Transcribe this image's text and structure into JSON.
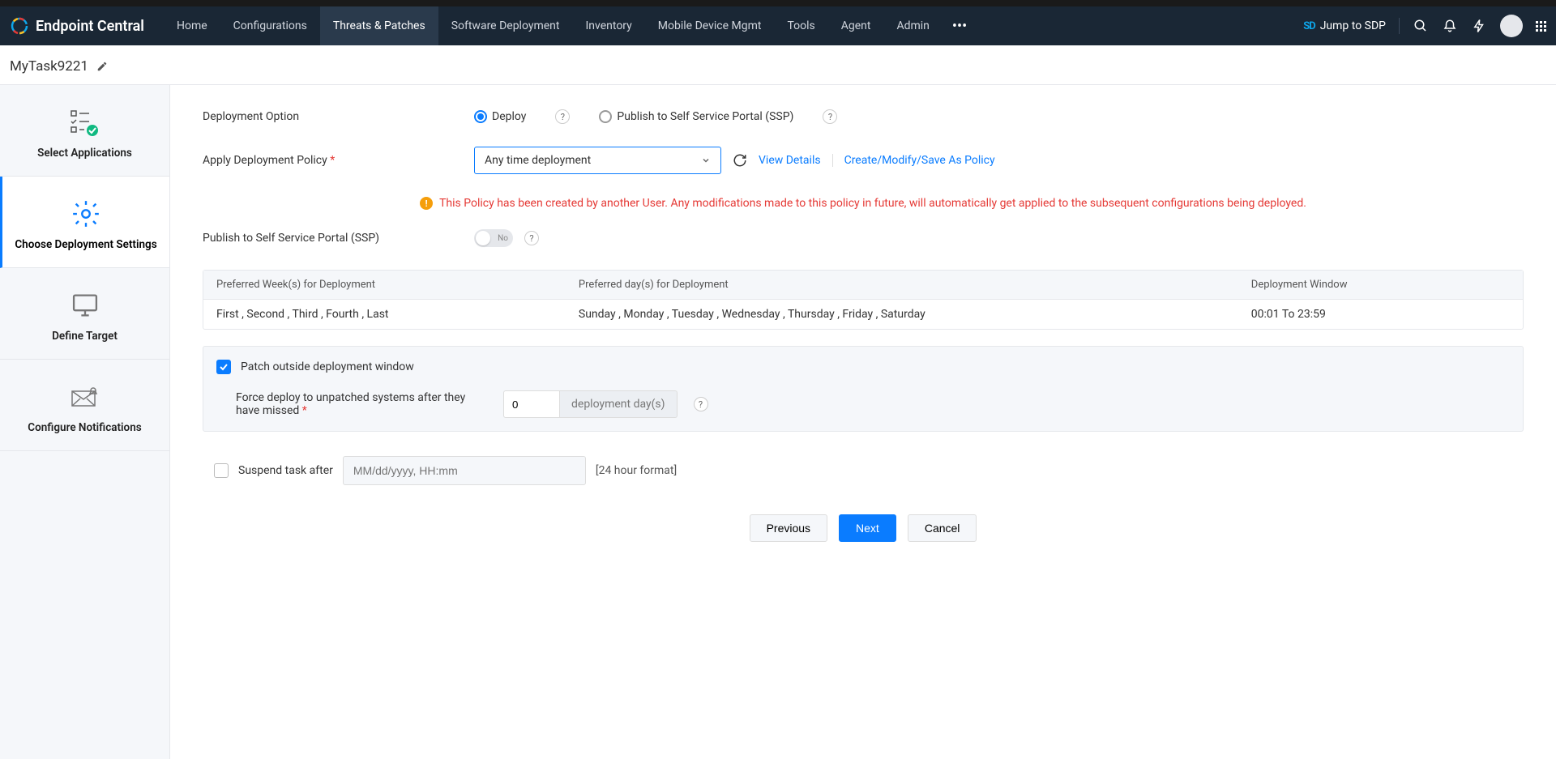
{
  "app": {
    "name": "Endpoint Central"
  },
  "nav": {
    "items": [
      "Home",
      "Configurations",
      "Threats & Patches",
      "Software Deployment",
      "Inventory",
      "Mobile Device Mgmt",
      "Tools",
      "Agent",
      "Admin"
    ],
    "active_index": 2
  },
  "header": {
    "sdp_label": "Jump to SDP"
  },
  "task": {
    "name": "MyTask9221"
  },
  "sidebar": {
    "steps": [
      "Select Applications",
      "Choose Deployment Settings",
      "Define Target",
      "Configure Notifications"
    ],
    "active_index": 1
  },
  "form": {
    "deployment_option_label": "Deployment Option",
    "deploy_option": "Deploy",
    "ssp_option": "Publish to Self Service Portal (SSP)",
    "apply_policy_label": "Apply Deployment Policy",
    "policy_value": "Any time deployment",
    "view_details": "View Details",
    "create_modify": "Create/Modify/Save As Policy",
    "warning": "This Policy has been created by another User. Any modifications made to this policy in future, will automatically get applied to the subsequent configurations being deployed.",
    "ssp_publish_label": "Publish to Self Service Portal (SSP)",
    "toggle_no": "No",
    "table": {
      "h1": "Preferred Week(s) for Deployment",
      "h2": "Preferred day(s) for Deployment",
      "h3": "Deployment Window",
      "c1": "First , Second , Third , Fourth , Last",
      "c2": "Sunday , Monday , Tuesday , Wednesday , Thursday , Friday , Saturday",
      "c3": "00:01 To 23:59"
    },
    "patch_outside_label": "Patch outside deployment window",
    "force_deploy_label": "Force deploy to unpatched systems after they have missed",
    "force_deploy_value": "0",
    "deployment_days_suffix": "deployment day(s)",
    "suspend_label": "Suspend task after",
    "suspend_placeholder": "MM/dd/yyyy, HH:mm",
    "format_hint": "[24 hour format]",
    "btn_prev": "Previous",
    "btn_next": "Next",
    "btn_cancel": "Cancel"
  }
}
